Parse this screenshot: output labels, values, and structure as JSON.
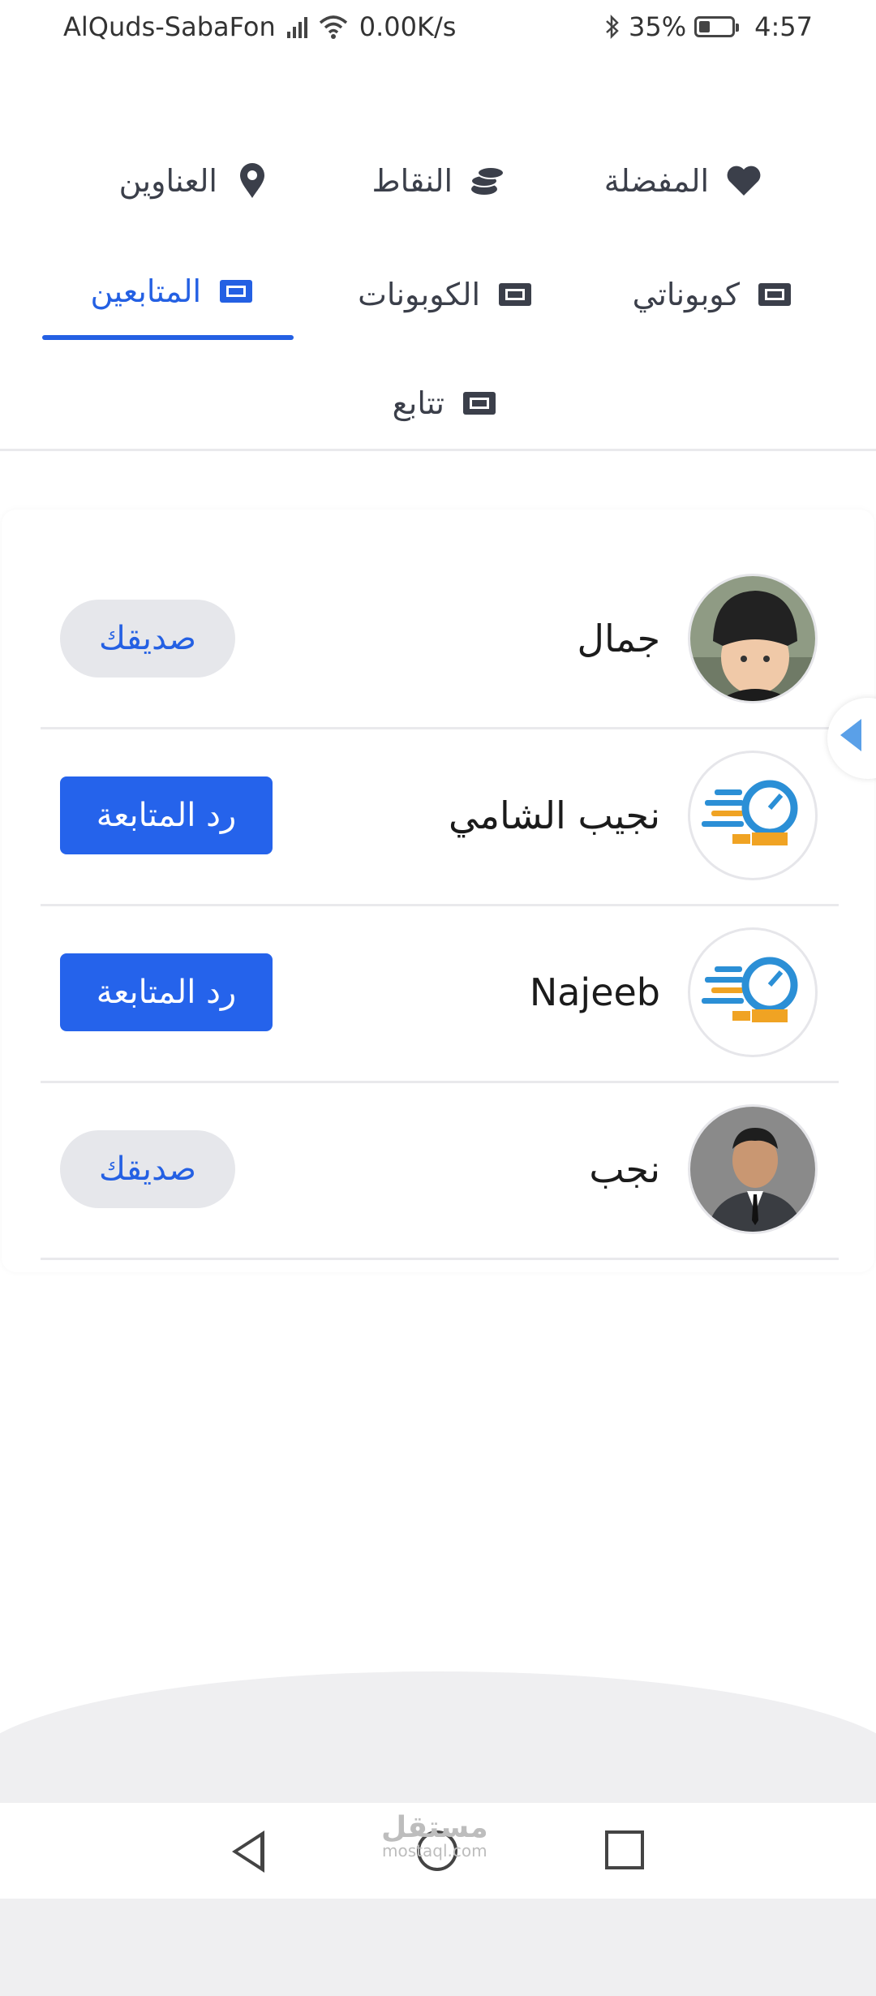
{
  "status_bar": {
    "carrier": "AlQuds-SabaFon",
    "speed": "0.00K/s",
    "battery": "35%",
    "time": "4:57",
    "battery_level": 0.35
  },
  "menu": {
    "row1": [
      {
        "label": "المفضلة",
        "icon": "heart-icon"
      },
      {
        "label": "النقاط",
        "icon": "coins-icon"
      },
      {
        "label": "العناوين",
        "icon": "location-pin-icon"
      }
    ],
    "row2": [
      {
        "label": "كوبوناتي",
        "icon": "ticket-icon"
      },
      {
        "label": "الكوبونات",
        "icon": "ticket-icon"
      },
      {
        "label": "المتابعين",
        "icon": "ticket-icon",
        "active": true
      }
    ],
    "row3": [
      {
        "label": "تتابع",
        "icon": "ticket-icon"
      }
    ]
  },
  "followers": [
    {
      "name": "جمال",
      "avatar": "child-photo",
      "action": "صديقك",
      "action_type": "friend"
    },
    {
      "name": "نجيب الشامي",
      "avatar": "now-logo",
      "action": "رد المتابعة",
      "action_type": "follow-back"
    },
    {
      "name": "Najeeb",
      "avatar": "now-logo",
      "action": "رد المتابعة",
      "action_type": "follow-back"
    },
    {
      "name": "نجب",
      "avatar": "man-photo",
      "action": "صديقك",
      "action_type": "friend"
    }
  ],
  "watermark": {
    "arabic": "مستقل",
    "latin": "mostaql.com"
  },
  "colors": {
    "accent": "#2460e3",
    "button_blue": "#2563eb",
    "friend_bg": "#e6e7eb"
  }
}
